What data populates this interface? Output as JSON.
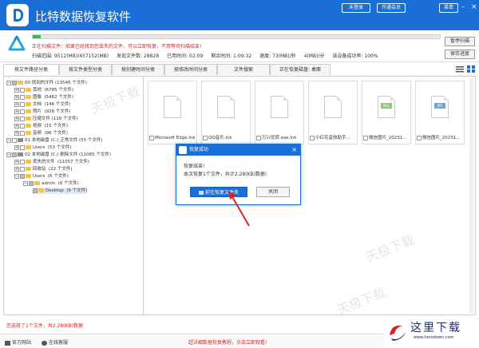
{
  "app": {
    "title": "比特数据恢复软件"
  },
  "titlebar": {
    "login": "未登录",
    "vip": "开通会员",
    "menu": "菜单"
  },
  "scan": {
    "progress": 0.02,
    "message": "正在扫描文件：如果已经找到您丢失的文件，可以立即恢复，不用等待扫描结束!",
    "stats": [
      "扫描范围: 9512(MB)/457152(MB)",
      "发现文件数: 28828",
      "已用时间: 02:09",
      "剩余时间: 1:09:32",
      "速度: 73(MB)/秒",
      "4(MB)/分",
      "该设备成功率: 100%"
    ],
    "pause_btn": "暂停扫描",
    "save_btn": "保存进度"
  },
  "tabs": [
    "按文件路径分类",
    "按文件类型分类",
    "按创建时间分类",
    "按修改时间分类",
    "文件搜索",
    "正在恢复磁盘: 桌面"
  ],
  "tree": [
    {
      "label": "00 找到的文件",
      "count": "(13546 个文件)"
    },
    {
      "label": "其他",
      "count": "(6785 个文件)"
    },
    {
      "label": "图像",
      "count": "(5462 个文件)"
    },
    {
      "label": "文档",
      "count": "(146 个文件)"
    },
    {
      "label": "照片",
      "count": "(926 个文件)"
    },
    {
      "label": "压缩文件",
      "count": "(116 个文件)"
    },
    {
      "label": "视频",
      "count": "(15 个文件)"
    },
    {
      "label": "音频",
      "count": "(96 个文件)"
    },
    {
      "label": "01 本地磁盘 (C:) 正常文件",
      "count": "(55 个文件)"
    },
    {
      "label": "Users",
      "count": "(53 个文件)"
    },
    {
      "label": "02 本地磁盘 (C:) 删除文件",
      "count": "(11085 个文件)"
    },
    {
      "label": "丢失的文件",
      "count": "(11057 个文件)"
    },
    {
      "label": "回收站",
      "count": "(22 个文件)"
    },
    {
      "label": "Users",
      "count": "(6 个文件)"
    },
    {
      "label": "admin",
      "count": "(6 个文件)"
    },
    {
      "label": "Desktop",
      "count": "(6 个文件)"
    }
  ],
  "files": [
    {
      "name": "Microsoft Edge.lnk",
      "type": "doc",
      "tag": ""
    },
    {
      "name": "QQ音乐.lnk",
      "type": "doc",
      "tag": ""
    },
    {
      "name": "万兴优转.exe.lnk",
      "type": "doc",
      "tag": ""
    },
    {
      "name": "小红花音效助手...",
      "type": "doc",
      "tag": ""
    },
    {
      "name": "微信图片_20231...",
      "type": "png",
      "tag": "PNG"
    },
    {
      "name": "微信图片_20231...",
      "type": "jpg",
      "tag": "JPG"
    }
  ],
  "dialog": {
    "title": "恢复成功",
    "line1": "恢复结束!",
    "line2": "本次恢复1个文件，共计2.28(KB)数据!",
    "open_btn": "前往恢复文件夹",
    "close_btn": "关闭"
  },
  "status": {
    "selected": "您选择了1个文件，共2.28(KB)数据"
  },
  "bottom": {
    "website": "官方网站",
    "service": "在线客服",
    "tutorial": "超详细数据恢复教程，点击立即观看!"
  },
  "watermarks": [
    "天极下载",
    "天极下载",
    "天极下载"
  ],
  "site_logo": {
    "cn": "这里下载",
    "url": "www.herodown.com"
  },
  "colors": {
    "brand": "#1a6fd6",
    "progress": "#2fbf4f",
    "warn": "#e02020"
  }
}
